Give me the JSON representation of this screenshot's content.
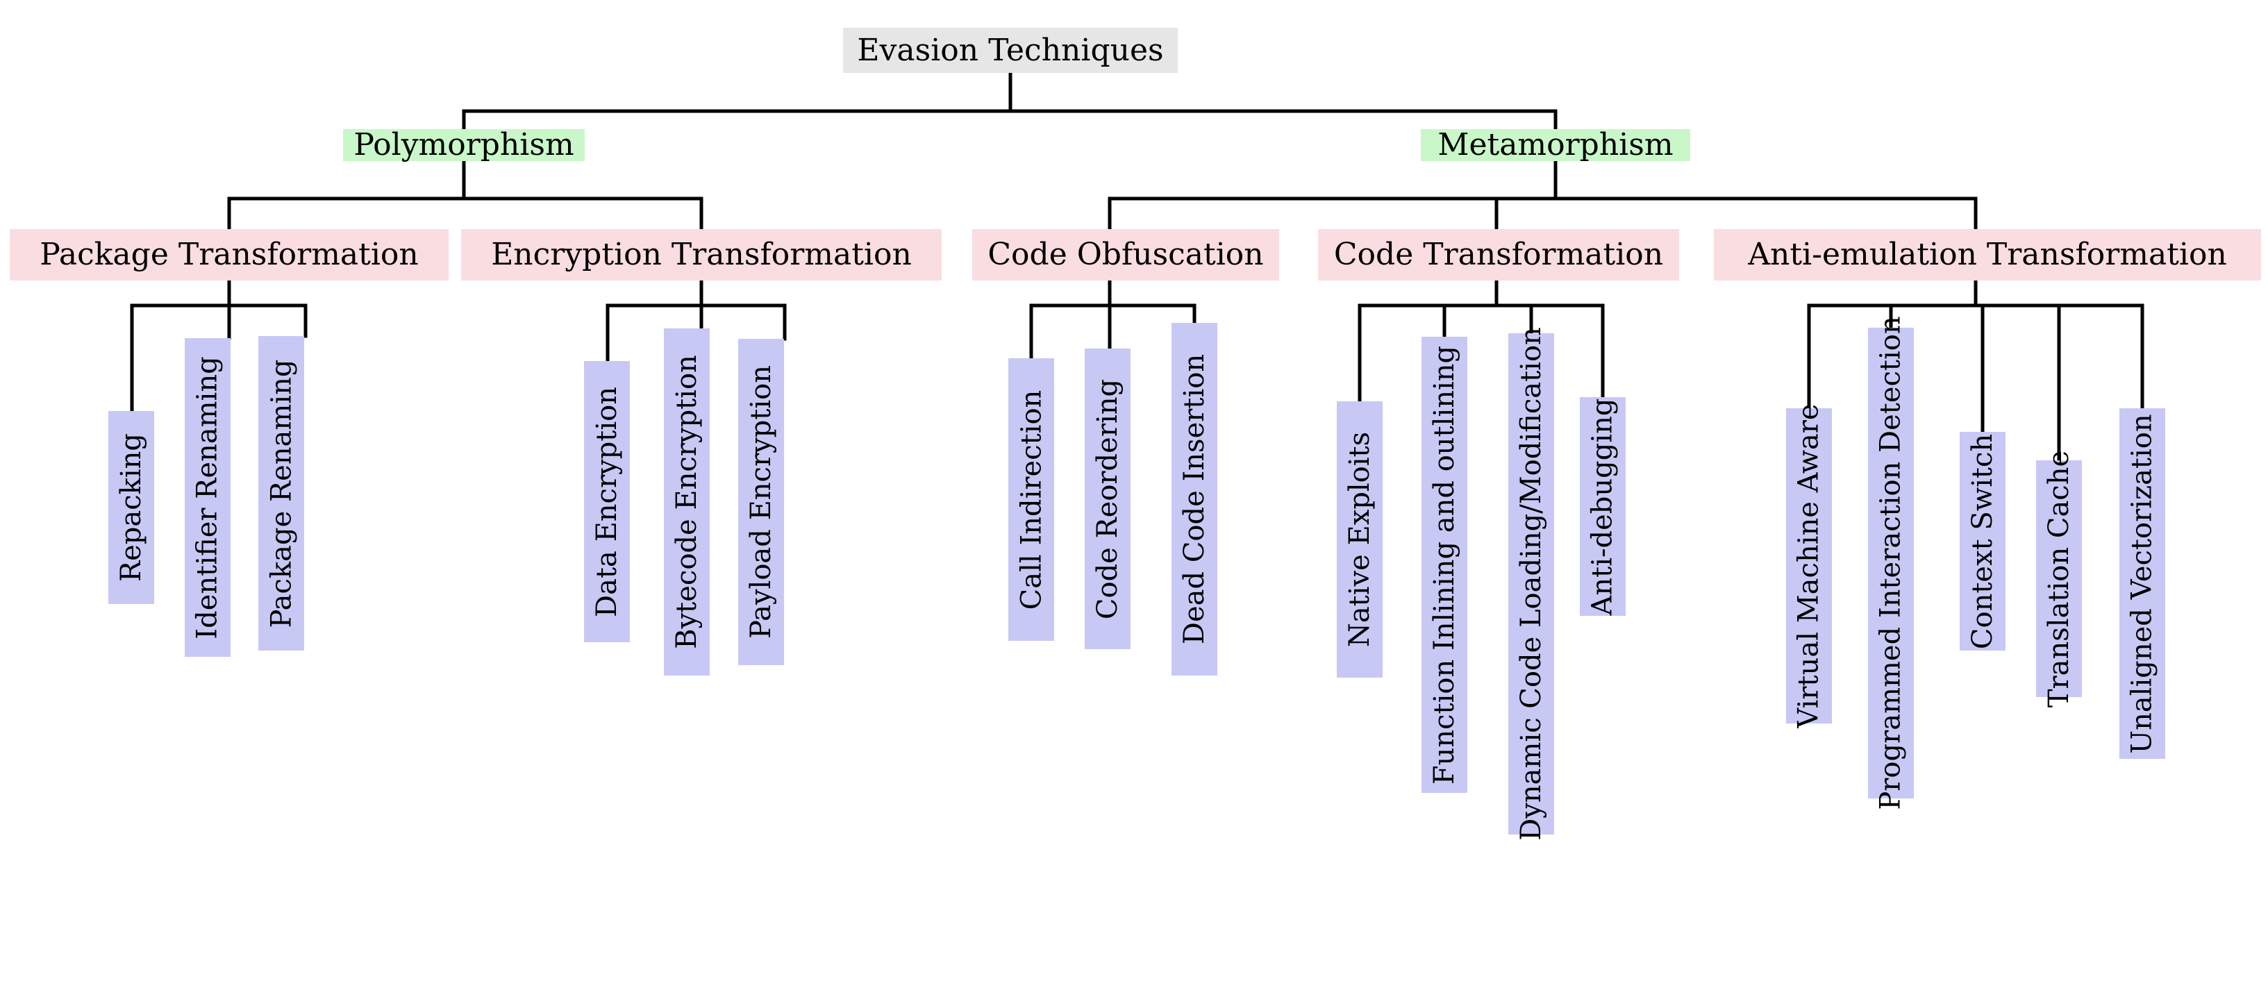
{
  "diagram": {
    "title": "Evasion Techniques",
    "colors": {
      "root_bg": "#e6e6e6",
      "category_bg": "#c9f7c9",
      "subcategory_bg": "#fadde1",
      "leaf_bg": "#c8c8f5",
      "edge": "#000000",
      "text": "#000000",
      "page_bg": "#ffffff"
    },
    "root": {
      "label": "Evasion Techniques"
    },
    "categories": [
      {
        "label": "Polymorphism"
      },
      {
        "label": "Metamorphism"
      }
    ],
    "subcategories": [
      {
        "label": "Package Transformation",
        "parent": "Polymorphism"
      },
      {
        "label": "Encryption Transformation",
        "parent": "Polymorphism"
      },
      {
        "label": "Code Obfuscation",
        "parent": "Metamorphism"
      },
      {
        "label": "Code Transformation",
        "parent": "Metamorphism"
      },
      {
        "label": "Anti-emulation Transformation",
        "parent": "Metamorphism"
      }
    ],
    "leaves": [
      {
        "label": "Repacking",
        "parent": "Package Transformation"
      },
      {
        "label": "Identifier Renaming",
        "parent": "Package Transformation"
      },
      {
        "label": "Package Renaming",
        "parent": "Package Transformation"
      },
      {
        "label": "Data Encryption",
        "parent": "Encryption Transformation"
      },
      {
        "label": "Bytecode Encryption",
        "parent": "Encryption Transformation"
      },
      {
        "label": "Payload Encryption",
        "parent": "Encryption Transformation"
      },
      {
        "label": "Call Indirection",
        "parent": "Code Obfuscation"
      },
      {
        "label": "Code Reordering",
        "parent": "Code Obfuscation"
      },
      {
        "label": "Dead Code Insertion",
        "parent": "Code Obfuscation"
      },
      {
        "label": "Native Exploits",
        "parent": "Code Transformation"
      },
      {
        "label": "Function Inlining and outlining",
        "parent": "Code Transformation"
      },
      {
        "label": "Dynamic Code Loading/Modification",
        "parent": "Code Transformation"
      },
      {
        "label": "Anti-debugging",
        "parent": "Code Transformation"
      },
      {
        "label": "Virtual Machine Aware",
        "parent": "Anti-emulation Transformation"
      },
      {
        "label": "Programmed Interaction Detection",
        "parent": "Anti-emulation Transformation"
      },
      {
        "label": "Context Switch",
        "parent": "Anti-emulation Transformation"
      },
      {
        "label": "Translation Cache",
        "parent": "Anti-emulation Transformation"
      },
      {
        "label": "Unaligned Vectorization",
        "parent": "Anti-emulation Transformation"
      }
    ]
  }
}
